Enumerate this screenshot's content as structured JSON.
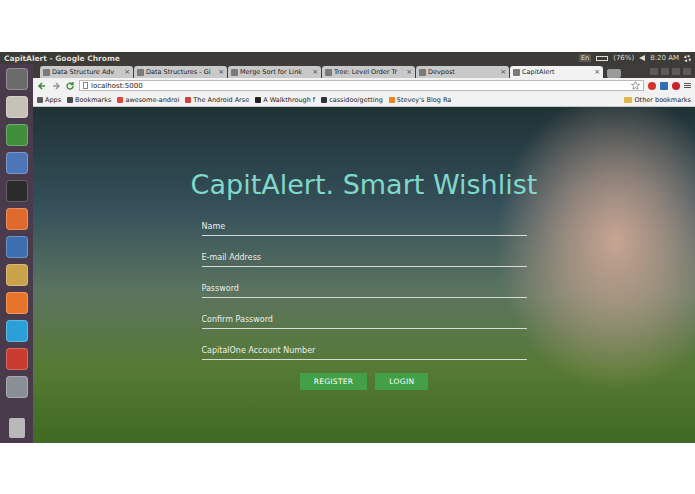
{
  "window": {
    "title": "CapitAlert - Google Chrome"
  },
  "panel": {
    "language": "En",
    "battery": "(76%)",
    "time": "8:20 AM"
  },
  "tabs": [
    {
      "label": "Data Structure Adv",
      "close": "×",
      "selected": false
    },
    {
      "label": "Data Structures - Gi",
      "close": "×",
      "selected": false
    },
    {
      "label": "Merge Sort for Link",
      "close": "×",
      "selected": false
    },
    {
      "label": "Tree: Level Order Tr",
      "close": "×",
      "selected": false
    },
    {
      "label": "Devpost",
      "close": "×",
      "selected": false
    },
    {
      "label": "CapitAlert",
      "close": "×",
      "selected": true
    }
  ],
  "address_bar": {
    "url": "localhost:5000"
  },
  "bookmarks": {
    "items": [
      "Apps",
      "Bookmarks",
      "awesome-androi",
      "The Android Arse",
      "A Walkthrough f",
      "cassidoo/getting",
      "Stevey's Blog Ra"
    ],
    "other": "Other bookmarks"
  },
  "page": {
    "title": "CapitAlert. Smart Wishlist",
    "fields": [
      {
        "placeholder": "Name"
      },
      {
        "placeholder": "E-mail Address"
      },
      {
        "placeholder": "Password"
      },
      {
        "placeholder": "Confirm Password"
      },
      {
        "placeholder": "CapitalOne Account Number"
      }
    ],
    "buttons": [
      {
        "label": "REGISTER"
      },
      {
        "label": "LOGIN"
      }
    ]
  }
}
